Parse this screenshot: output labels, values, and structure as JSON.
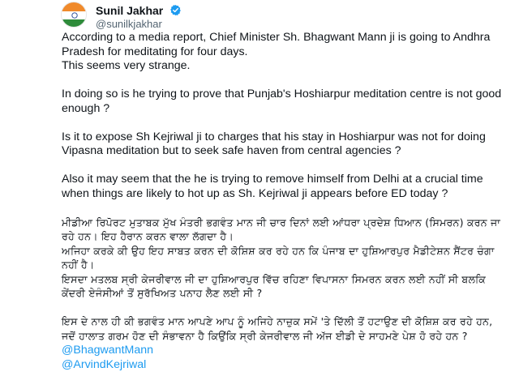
{
  "author": {
    "display_name": "Sunil Jakhar",
    "handle": "@sunilkjakhar",
    "verified_icon": "verified-badge-icon",
    "avatar_icon": "tricolor-flag-avatar"
  },
  "tweet": {
    "paragraphs": [
      "According to a media report, Chief Minister Sh. Bhagwant Mann ji is going  to Andhra Pradesh for meditating for four days.\nThis seems very strange.",
      "In doing so is he trying to prove that Punjab's Hoshiarpur meditation centre is not good enough ?",
      "Is it to expose Sh Kejriwal ji to charges that his stay in Hoshiarpur was not for doing Vipasna meditation but to seek safe haven from central agencies ?",
      "Also it may seem that the he is trying to remove himself from Delhi at  a crucial time when things are likely to hot up as Sh.  Kejriwal ji appears before ED today ?"
    ],
    "punjabi_paragraphs": [
      "ਮੀਡੀਆ ਰਿਪੋਰਟ ਮੁਤਾਬਕ ਮੁੱਖ ਮੰਤਰੀ ਭਗਵੰਤ ਮਾਨ ਜੀ ਚਾਰ ਦਿਨਾਂ ਲਈ ਆਂਧਰਾ ਪ੍ਰਦੇਸ਼ ਧਿਆਨ (ਸਿਮਰਨ) ਕਰਨ ਜਾ ਰਹੇ ਹਨ। ਇਹ ਹੈਰਾਨ ਕਰਨ ਵਾਲਾ ਲੱਗਦਾ ਹੈ।\nਅਜਿਹਾ ਕਰਕੇ ਕੀ ਉਹ ਇਹ ਸਾਬਤ ਕਰਨ ਦੀ ਕੋਸ਼ਿਸ਼ ਕਰ ਰਹੇ ਹਨ ਕਿ ਪੰਜਾਬ ਦਾ ਹੁਸ਼ਿਆਰਪੁਰ ਮੈਡੀਟੇਸ਼ਨ ਸੈਂਟਰ ਚੰਗਾ ਨਹੀਂ ਹੈ।\nਇਸਦਾ ਮਤਲਬ ਸ੍ਰੀ ਕੇਜਰੀਵਾਲ ਜੀ ਦਾ ਹੁਸ਼ਿਆਰਪੁਰ ਵਿੱਚ ਰਹਿਣਾ ਵਿਪਾਸਨਾ ਸਿਮਰਨ ਕਰਨ ਲਈ ਨਹੀਂ ਸੀ ਬਲਕਿ ਕੇਂਦਰੀ ਏਜੰਸੀਆਂ ਤੋਂ ਸੁਰੱਖਿਅਤ ਪਨਾਹ ਲੈਣ ਲਈ ਸੀ ?",
      "ਇਸ ਦੇ ਨਾਲ ਹੀ ਕੀ ਭਗਵੰਤ ਮਾਨ ਆਪਣੇ ਆਪ ਨੂੰ ਅਜਿਹੇ ਨਾਜ਼ੁਕ ਸਮੇਂ 'ਤੇ ਦਿੱਲੀ ਤੋਂ ਹਟਾਉਣ ਦੀ ਕੋਸ਼ਿਸ਼ ਕਰ ਰਹੇ ਹਨ, ਜਦੋਂ ਹਾਲਾਤ ਗਰਮ ਹੋਣ ਦੀ ਸੰਭਾਵਨਾ ਹੈ ਕਿਉਂਕਿ ਸ੍ਰੀ ਕੇਜਰੀਵਾਲ ਜੀ ਅੱਜ ਈਡੀ ਦੇ ਸਾਹਮਣੇ ਪੇਸ਼ ਹੋ ਰਹੇ ਹਨ ?"
    ],
    "mentions": [
      "@BhagwantMann",
      "@ArvindKejriwal"
    ]
  },
  "colors": {
    "text": "#0f1419",
    "secondary": "#536471",
    "link": "#1d9bf0",
    "verified": "#1d9bf0"
  }
}
